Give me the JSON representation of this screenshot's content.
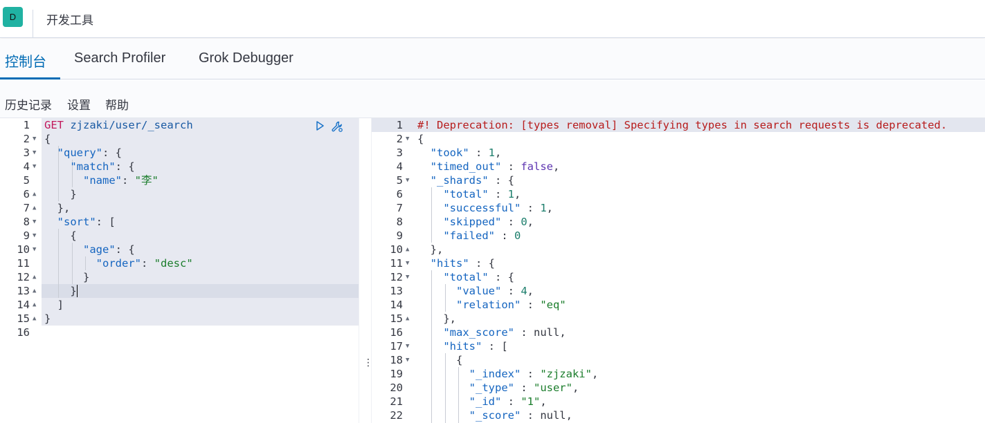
{
  "header": {
    "avatar_letter": "D",
    "title": "开发工具"
  },
  "tabs": [
    {
      "label": "控制台",
      "active": true
    },
    {
      "label": "Search Profiler",
      "active": false
    },
    {
      "label": "Grok Debugger",
      "active": false
    }
  ],
  "toolbar": {
    "history": "历史记录",
    "settings": "设置",
    "help": "帮助"
  },
  "request_editor": {
    "line_numbers": [
      "1",
      "2",
      "3",
      "4",
      "5",
      "6",
      "7",
      "8",
      "9",
      "10",
      "11",
      "12",
      "13",
      "14",
      "15",
      "16"
    ],
    "method": "GET",
    "url": "zjzaki/user/_search",
    "query_key": "\"query\"",
    "match_key": "\"match\"",
    "name_key": "\"name\"",
    "name_value": "\"李\"",
    "sort_key": "\"sort\"",
    "age_key": "\"age\"",
    "order_key": "\"order\"",
    "order_value": "\"desc\"",
    "run_icon": "play-icon",
    "wrench_icon": "wrench-icon"
  },
  "response_editor": {
    "line_numbers": [
      "1",
      "2",
      "3",
      "4",
      "5",
      "6",
      "7",
      "8",
      "9",
      "10",
      "11",
      "12",
      "13",
      "14",
      "15",
      "16",
      "17",
      "18",
      "19",
      "20",
      "21",
      "22"
    ],
    "deprecation": "#! Deprecation: [types removal] Specifying types in search requests is deprecated.",
    "took_key": "\"took\"",
    "took_value": "1",
    "timed_out_key": "\"timed_out\"",
    "timed_out_value": "false",
    "shards_key": "\"_shards\"",
    "total_key": "\"total\"",
    "total_value": "1",
    "successful_key": "\"successful\"",
    "successful_value": "1",
    "skipped_key": "\"skipped\"",
    "skipped_value": "0",
    "failed_key": "\"failed\"",
    "failed_value": "0",
    "hits_key": "\"hits\"",
    "hits_total_key": "\"total\"",
    "value_key": "\"value\"",
    "value_value": "4",
    "relation_key": "\"relation\"",
    "relation_value": "\"eq\"",
    "max_score_key": "\"max_score\"",
    "max_score_value": "null",
    "hits_array_key": "\"hits\"",
    "index_key": "\"_index\"",
    "index_value": "\"zjzaki\"",
    "type_key": "\"_type\"",
    "type_value": "\"user\"",
    "id_key": "\"_id\"",
    "id_value": "\"1\"",
    "score_key": "\"_score\"",
    "score_value": "null"
  },
  "resizer_glyph": "⋮"
}
